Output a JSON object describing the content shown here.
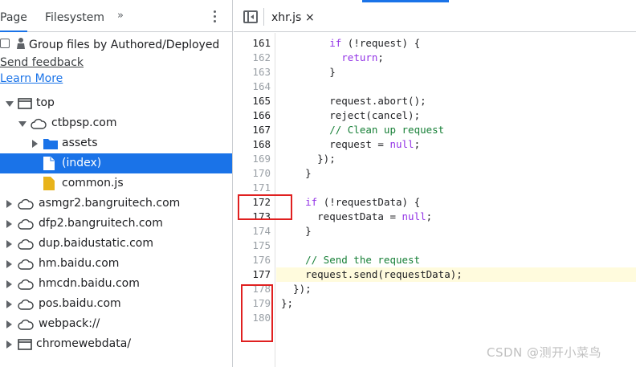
{
  "left_panel": {
    "tabs": [
      "Page",
      "Filesystem"
    ],
    "more_tabs": "»",
    "group_checkbox_label": "Group files by Authored/Deployed",
    "send_feedback": "Send feedback",
    "learn_more": "Learn More",
    "tree": [
      {
        "label": "top",
        "icon": "frame-icon",
        "expander": "down"
      },
      {
        "label": "ctbpsp.com",
        "icon": "cloud-icon",
        "expander": "down"
      },
      {
        "label": "assets",
        "icon": "folder-icon",
        "expander": "right"
      },
      {
        "label": "(index)",
        "icon": "file-icon",
        "expander": "",
        "selected": true
      },
      {
        "label": "common.js",
        "icon": "js-file-icon",
        "expander": ""
      },
      {
        "label": "asmgr2.bangruitech.com",
        "icon": "cloud-icon",
        "expander": "right"
      },
      {
        "label": "dfp2.bangruitech.com",
        "icon": "cloud-icon",
        "expander": "right"
      },
      {
        "label": "dup.baidustatic.com",
        "icon": "cloud-icon",
        "expander": "right"
      },
      {
        "label": "hm.baidu.com",
        "icon": "cloud-icon",
        "expander": "right"
      },
      {
        "label": "hmcdn.baidu.com",
        "icon": "cloud-icon",
        "expander": "right"
      },
      {
        "label": "pos.baidu.com",
        "icon": "cloud-icon",
        "expander": "right"
      },
      {
        "label": "webpack://",
        "icon": "cloud-icon",
        "expander": "right"
      },
      {
        "label": "chromewebdata/",
        "icon": "frame-icon",
        "expander": "right"
      }
    ]
  },
  "editor": {
    "file_tab": "xhr.js",
    "close_glyph": "×",
    "lines": [
      {
        "n": "161",
        "code": "        if (!request) {"
      },
      {
        "n": "162",
        "code": "          return;"
      },
      {
        "n": "163",
        "code": "        }"
      },
      {
        "n": "164",
        "code": ""
      },
      {
        "n": "165",
        "code": "        request.abort();"
      },
      {
        "n": "166",
        "code": "        reject(cancel);"
      },
      {
        "n": "167",
        "code": "        // Clean up request"
      },
      {
        "n": "168",
        "code": "        request = null;"
      },
      {
        "n": "169",
        "code": "      });"
      },
      {
        "n": "170",
        "code": "    }"
      },
      {
        "n": "171",
        "code": ""
      },
      {
        "n": "172",
        "code": "    if (!requestData) {"
      },
      {
        "n": "173",
        "code": "      requestData = null;"
      },
      {
        "n": "174",
        "code": "    }"
      },
      {
        "n": "175",
        "code": ""
      },
      {
        "n": "176",
        "code": "    // Send the request"
      },
      {
        "n": "177",
        "code": "    request.send(requestData);"
      },
      {
        "n": "178",
        "code": "  });"
      },
      {
        "n": "179",
        "code": "};"
      },
      {
        "n": "180",
        "code": ""
      }
    ],
    "current_line": "177"
  },
  "watermark": "CSDN @测开小菜鸟"
}
